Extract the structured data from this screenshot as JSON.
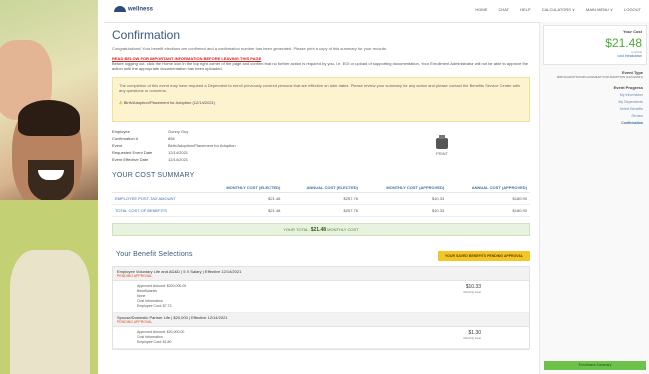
{
  "nav": {
    "logo": "wellness",
    "items": [
      "HOME",
      "CHAT",
      "HELP",
      "CALCULATORS ∨",
      "MAIN MENU ∨",
      "LOGOUT"
    ]
  },
  "page": {
    "title": "Confirmation",
    "intro": "Congratulations! Your benefit elections are confirmed and a confirmation number has been generated. Please print a copy of this summary for your records.",
    "warning_title": "READ BELOW FOR IMPORTANT INFORMATION BEFORE LEAVING THIS PAGE",
    "warning_text": "Before logging out, click the Home icon in the top right corner of the page and confirm that no further action is required by you, i.e. EOI or upload of supporting documentation. Your Enrollment Administrator will not be able to approve the action until the appropriate documentation has been uploaded.",
    "notice_text": "The completion of this event may have required a Dependent to enroll previously covered persons that are effective on later dates. Please review your summary for any action and please contact the Benefits Service Center with any questions or concerns.",
    "notice_doc_label": "Birth/Adoption/Placement for Adoption",
    "notice_doc_date": "(12/14/2021)"
  },
  "details": [
    {
      "label": "Employee",
      "value": "Gunny Guy"
    },
    {
      "label": "Confirmation #",
      "value": "856"
    },
    {
      "label": "Event",
      "value": "Birth/Adoption/Placement for Adoption"
    },
    {
      "label": "Requested Event Date",
      "value": "12/14/2021"
    },
    {
      "label": "Event Effective Date",
      "value": "12/14/2021"
    }
  ],
  "print_label": "PRINT",
  "cost_summary": {
    "title": "YOUR COST SUMMARY",
    "columns": [
      "",
      "MONTHLY COST (ELECTED)",
      "ANNUAL COST (ELECTED)",
      "MONTHLY COST (APPROVED)",
      "ANNUAL COST (APPROVED)"
    ],
    "rows": [
      [
        "EMPLOYEE POST-TAX AMOUNT",
        "$21.48",
        "$257.76",
        "$10.33",
        "$180.90"
      ],
      [
        "TOTAL COST OF BENEFITS",
        "$21.48",
        "$257.76",
        "$10.33",
        "$180.90"
      ]
    ],
    "total_label": "YOUR TOTAL:",
    "total_value": "$21.48",
    "total_suffix": "MONTHLY COST"
  },
  "selections": {
    "title": "Your Benefit Selections",
    "button": "YOUR SAVED BENEFITS PENDING APPROVAL",
    "plans": [
      {
        "head": "Employee Voluntary Life and AD&D  |  5 X Salary  |  Effective 12/14/2021",
        "pending": "PENDING APPROVAL",
        "lines": [
          "Approved Amount: $200,000.00",
          "Beneficiaries",
          "None",
          "Cost Information",
          "Employee Cost: $7.73"
        ],
        "amount": "$10.33",
        "amount_label": "Monthly Cost"
      },
      {
        "head": "Spouse/Domestic Partner Life  |  $20,000  |  Effective 12/14/2021",
        "pending": "PENDING APPROVAL",
        "lines": [
          "Approved Amount: $20,000.00",
          "Cost Information",
          "Employee Cost: $1.80"
        ],
        "amount": "$1.30",
        "amount_label": "Monthly Cost"
      }
    ]
  },
  "sidebar": {
    "cost_label": "Your Cost",
    "cost_value": "$21.48",
    "cost_period": "monthly",
    "cost_link": "cost breakdown",
    "event_type_label": "Event Type",
    "event_type_value": "BIRTH/ADOPTION/PLACEMENT FOR ADOPTION (12/14/2021)",
    "progress_label": "Event Progress",
    "progress_items": [
      "My Information",
      "My Dependents",
      "Select Benefits",
      "Review",
      "Confirmation"
    ],
    "bottom_button": "Enrollment Summary"
  }
}
